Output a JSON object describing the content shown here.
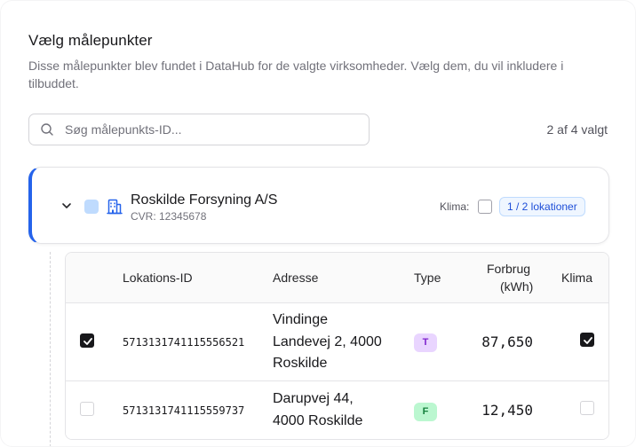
{
  "header": {
    "title": "Vælg målepunkter",
    "description": "Disse målepunkter blev fundet i DataHub for de valgte virksomheder. Vælg dem, du vil inkludere i tilbuddet."
  },
  "search": {
    "placeholder": "Søg målepunkts-ID...",
    "value": ""
  },
  "selection_count": "2 af 4 valgt",
  "company": {
    "name": "Roskilde Forsyning A/S",
    "cvr": "CVR: 12345678",
    "klima_label": "Klima:",
    "klima_checked": false,
    "locations_badge": "1 / 2 lokationer",
    "accent_color": "#2563eb"
  },
  "table": {
    "columns": {
      "location_id": "Lokations-ID",
      "address": "Adresse",
      "type": "Type",
      "consumption_line1": "Forbrug",
      "consumption_line2": "(kWh)",
      "climate": "Klima"
    },
    "rows": [
      {
        "selected": true,
        "location_id": "5713131741115556521",
        "address_line1": "Vindinge",
        "address_line2": "Landevej 2, 4000",
        "address_line3": "Roskilde",
        "type": "T",
        "consumption": "87,650",
        "climate": true
      },
      {
        "selected": false,
        "location_id": "5713131741115559737",
        "address_line1": "Darupvej 44,",
        "address_line2": "4000 Roskilde",
        "type": "F",
        "consumption": "12,450",
        "climate": false
      }
    ]
  }
}
